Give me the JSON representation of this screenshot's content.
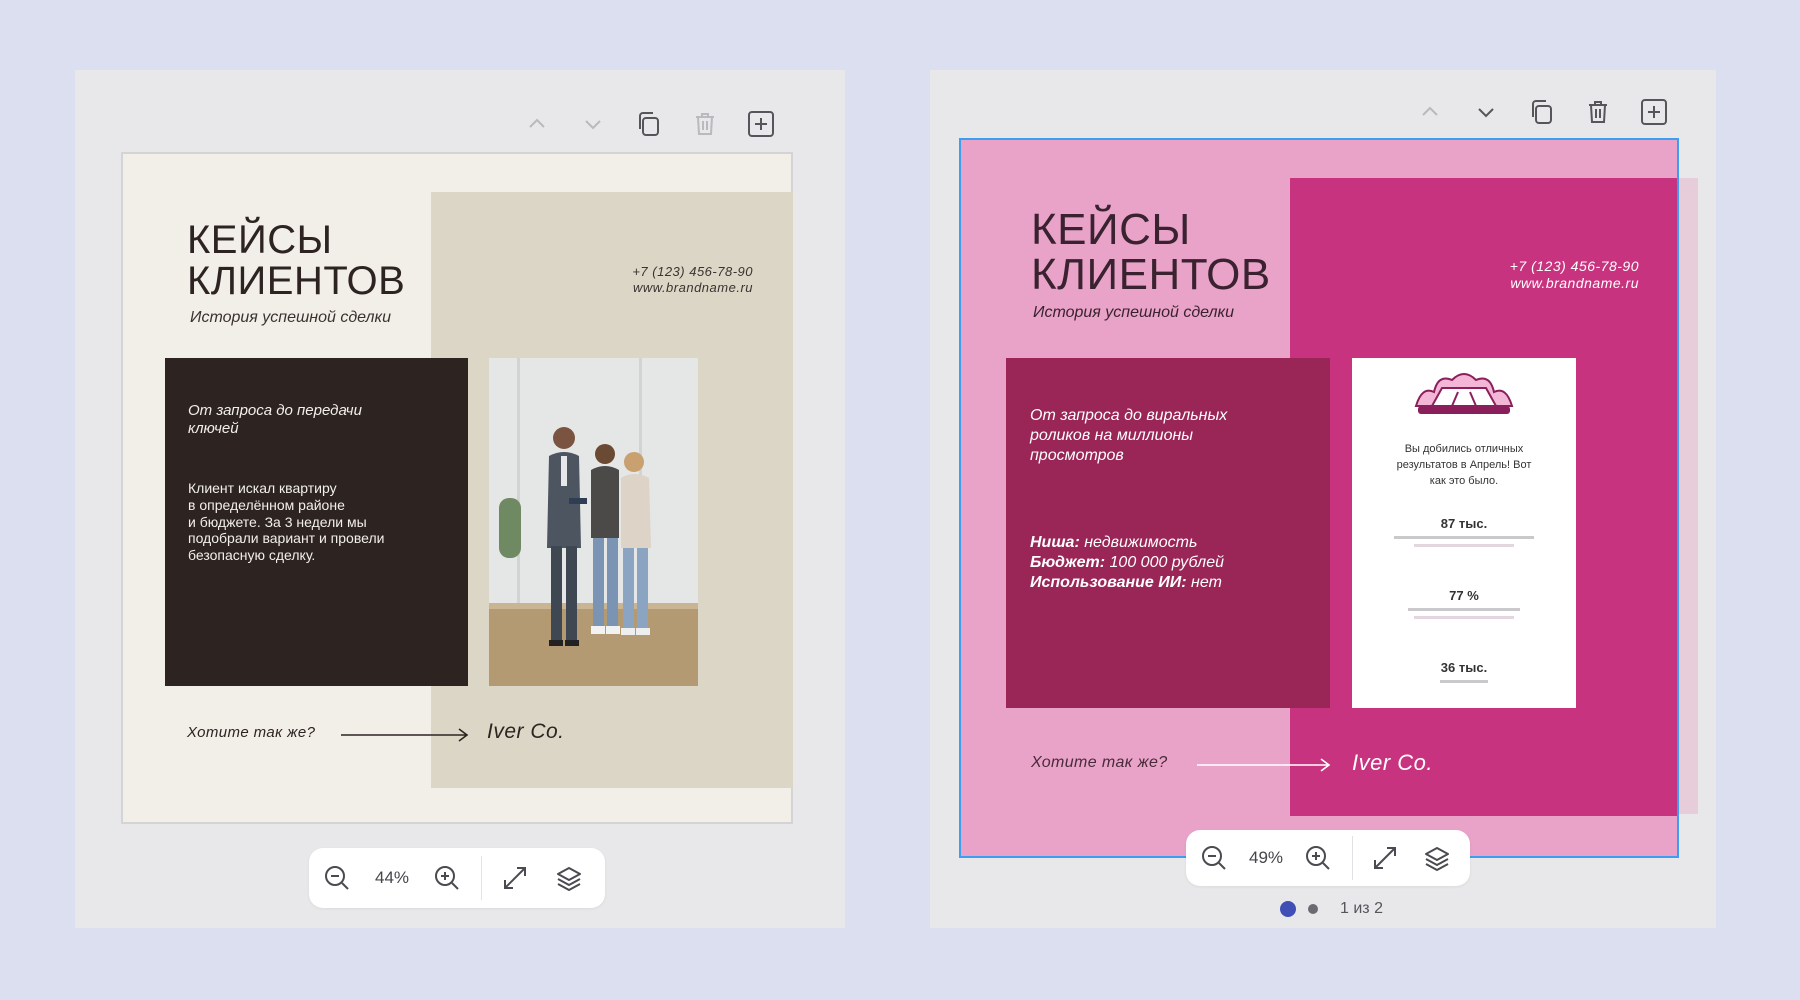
{
  "left": {
    "toolbar": {
      "icons": [
        "chevron-up-icon",
        "chevron-down-icon",
        "copy-icon",
        "trash-icon",
        "add-page-icon"
      ]
    },
    "slide": {
      "title_line1": "КЕЙСЫ",
      "title_line2": "КЛИЕНТОВ",
      "subtitle": "История успешной сделки",
      "phone": "+7 (123) 456-78-90",
      "website": "www.brandname.ru",
      "card_heading_l1": "От запроса до передачи",
      "card_heading_l2": "ключей",
      "card_body": [
        "Клиент искал квартиру",
        "в определённом районе",
        "и бюджете.  За 3 недели мы",
        "подобрали вариант и провели",
        "безопасную сделку."
      ],
      "cta": "Хотите так же?",
      "brand": "Iver Co.",
      "colors": {
        "bg": "#f2efe9",
        "beige": "#dcd6c6",
        "dark": "#2d2422"
      }
    },
    "zoom": {
      "value": "44%"
    }
  },
  "right": {
    "toolbar": {
      "icons": [
        "chevron-up-icon",
        "chevron-down-icon",
        "copy-icon",
        "trash-icon",
        "add-page-icon"
      ]
    },
    "slide": {
      "title_line1": "КЕЙСЫ",
      "title_line2": "КЛИЕНТОВ",
      "subtitle": "История успешной сделки",
      "phone": "+7 (123) 456-78-90",
      "website": "www.brandname.ru",
      "card_heading": [
        "От запроса до виральных",
        "роликов на миллионы",
        "просмотров"
      ],
      "niche_label": "Ниша:",
      "niche_value": " недвижимость",
      "budget_label": "Бюджет:",
      "budget_value": " 100 000 рублей",
      "ai_label": "Использование ИИ:",
      "ai_value": " нет",
      "result_card": {
        "heading": [
          "Вы добились отличных",
          "результатов в Апрель! Вот",
          "как это было."
        ],
        "stat1": "87 тыс.",
        "stat2": "77 %",
        "stat3": "36 тыс."
      },
      "cta": "Хотите так же?",
      "brand": "Iver Co.",
      "colors": {
        "bg": "#e9a3c8",
        "magenta": "#c8337f",
        "wine": "#9a2657"
      }
    },
    "zoom": {
      "value": "49%"
    },
    "pagination": {
      "text": "1 из 2"
    }
  }
}
